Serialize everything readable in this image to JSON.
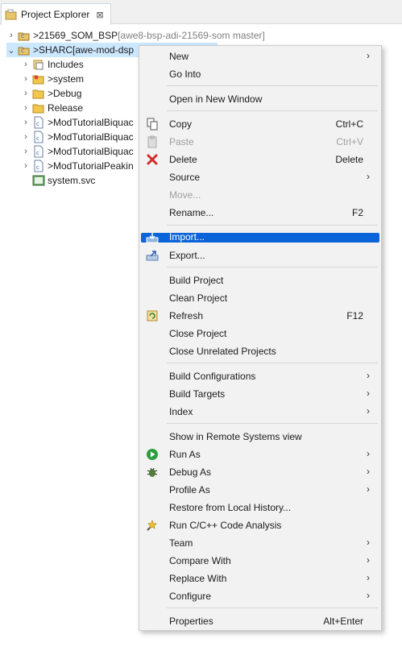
{
  "tab": {
    "title": "Project Explorer",
    "close_glyph": "⊠",
    "icon": "project-explorer-icon"
  },
  "tree": {
    "rows": [
      {
        "prefix": "> ",
        "label": "21569_SOM_BSP",
        "suffix": " [awe8-bsp-adi-21569-som master]"
      },
      {
        "prefix": "> ",
        "label": "SHARC",
        "suffix": " [awe-mod-dsp"
      },
      {
        "label": "Includes"
      },
      {
        "prefix": "> ",
        "label": "system"
      },
      {
        "prefix": "> ",
        "label": "Debug"
      },
      {
        "label": "Release"
      },
      {
        "prefix": "> ",
        "label": "ModTutorialBiquac"
      },
      {
        "prefix": "> ",
        "label": "ModTutorialBiquac"
      },
      {
        "prefix": "> ",
        "label": "ModTutorialBiquac"
      },
      {
        "prefix": "> ",
        "label": "ModTutorialPeakin"
      },
      {
        "label": "system.svc"
      }
    ]
  },
  "menu": {
    "items": [
      {
        "label": "New"
      },
      {
        "label": "Go Into"
      },
      {
        "label": "Open in New Window"
      },
      {
        "label": "Copy",
        "shortcut": "Ctrl+C"
      },
      {
        "label": "Paste",
        "shortcut": "Ctrl+V"
      },
      {
        "label": "Delete",
        "shortcut": "Delete"
      },
      {
        "label": "Source"
      },
      {
        "label": "Move..."
      },
      {
        "label": "Rename...",
        "shortcut": "F2"
      },
      {
        "label": "Import..."
      },
      {
        "label": "Export..."
      },
      {
        "label": "Build Project"
      },
      {
        "label": "Clean Project"
      },
      {
        "label": "Refresh",
        "shortcut": "F12"
      },
      {
        "label": "Close Project"
      },
      {
        "label": "Close Unrelated Projects"
      },
      {
        "label": "Build Configurations"
      },
      {
        "label": "Build Targets"
      },
      {
        "label": "Index"
      },
      {
        "label": "Show in Remote Systems view"
      },
      {
        "label": "Run As"
      },
      {
        "label": "Debug As"
      },
      {
        "label": "Profile As"
      },
      {
        "label": "Restore from Local History..."
      },
      {
        "label": "Run C/C++ Code Analysis"
      },
      {
        "label": "Team"
      },
      {
        "label": "Compare With"
      },
      {
        "label": "Replace With"
      },
      {
        "label": "Configure"
      },
      {
        "label": "Properties",
        "shortcut": "Alt+Enter"
      }
    ],
    "submenu_arrow": "›"
  },
  "colors": {
    "highlight": "#0a64d8",
    "selection": "#cce8ff",
    "git_decoration": "#808080"
  }
}
